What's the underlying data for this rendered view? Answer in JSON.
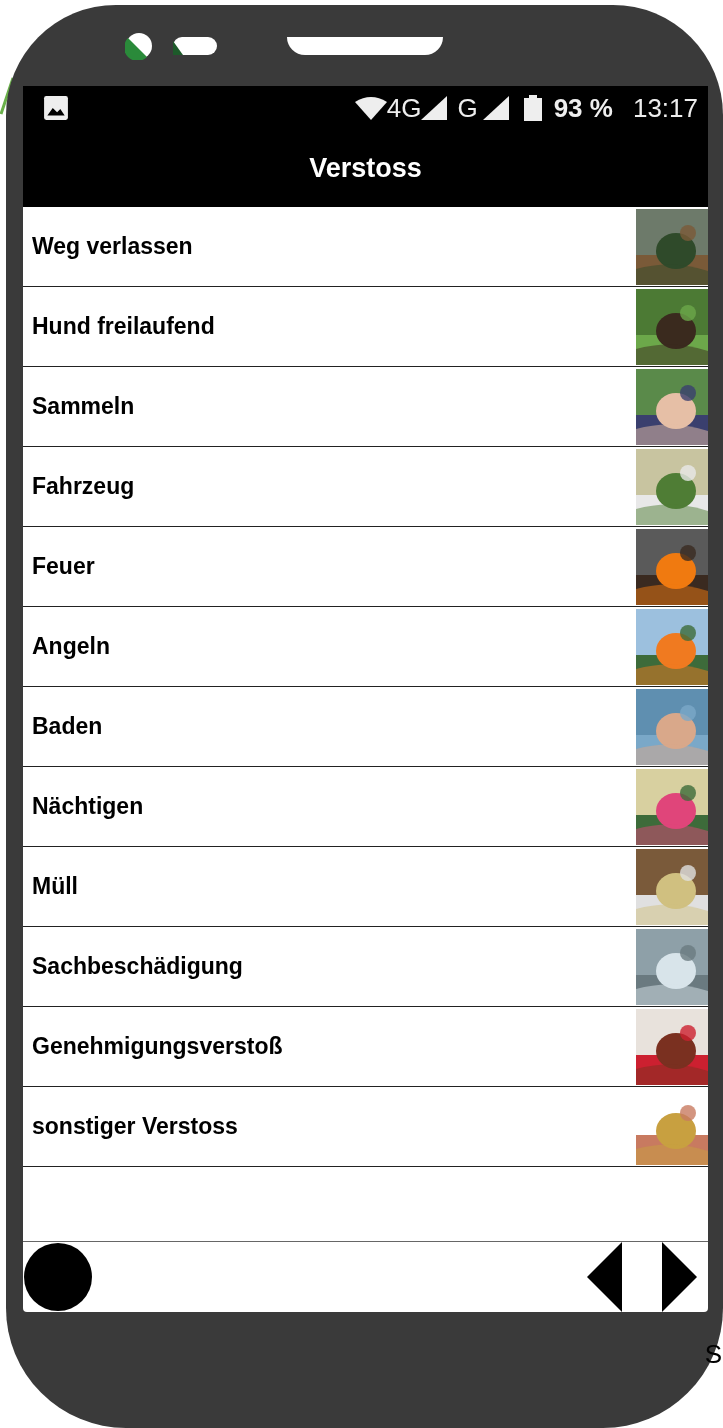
{
  "status_bar": {
    "network_1": "4G",
    "network_2": "G",
    "battery": "93 %",
    "time": "13:17"
  },
  "title": "Verstoss",
  "items": [
    {
      "label": "Weg verlassen"
    },
    {
      "label": "Hund freilaufend"
    },
    {
      "label": "Sammeln"
    },
    {
      "label": "Fahrzeug"
    },
    {
      "label": "Feuer"
    },
    {
      "label": "Angeln"
    },
    {
      "label": "Baden"
    },
    {
      "label": "Nächtigen"
    },
    {
      "label": "Müll"
    },
    {
      "label": "Sachbeschädigung"
    },
    {
      "label": "Genehmigungsverstoß"
    },
    {
      "label": "sonstiger Verstoss"
    }
  ],
  "corner_text": "S"
}
